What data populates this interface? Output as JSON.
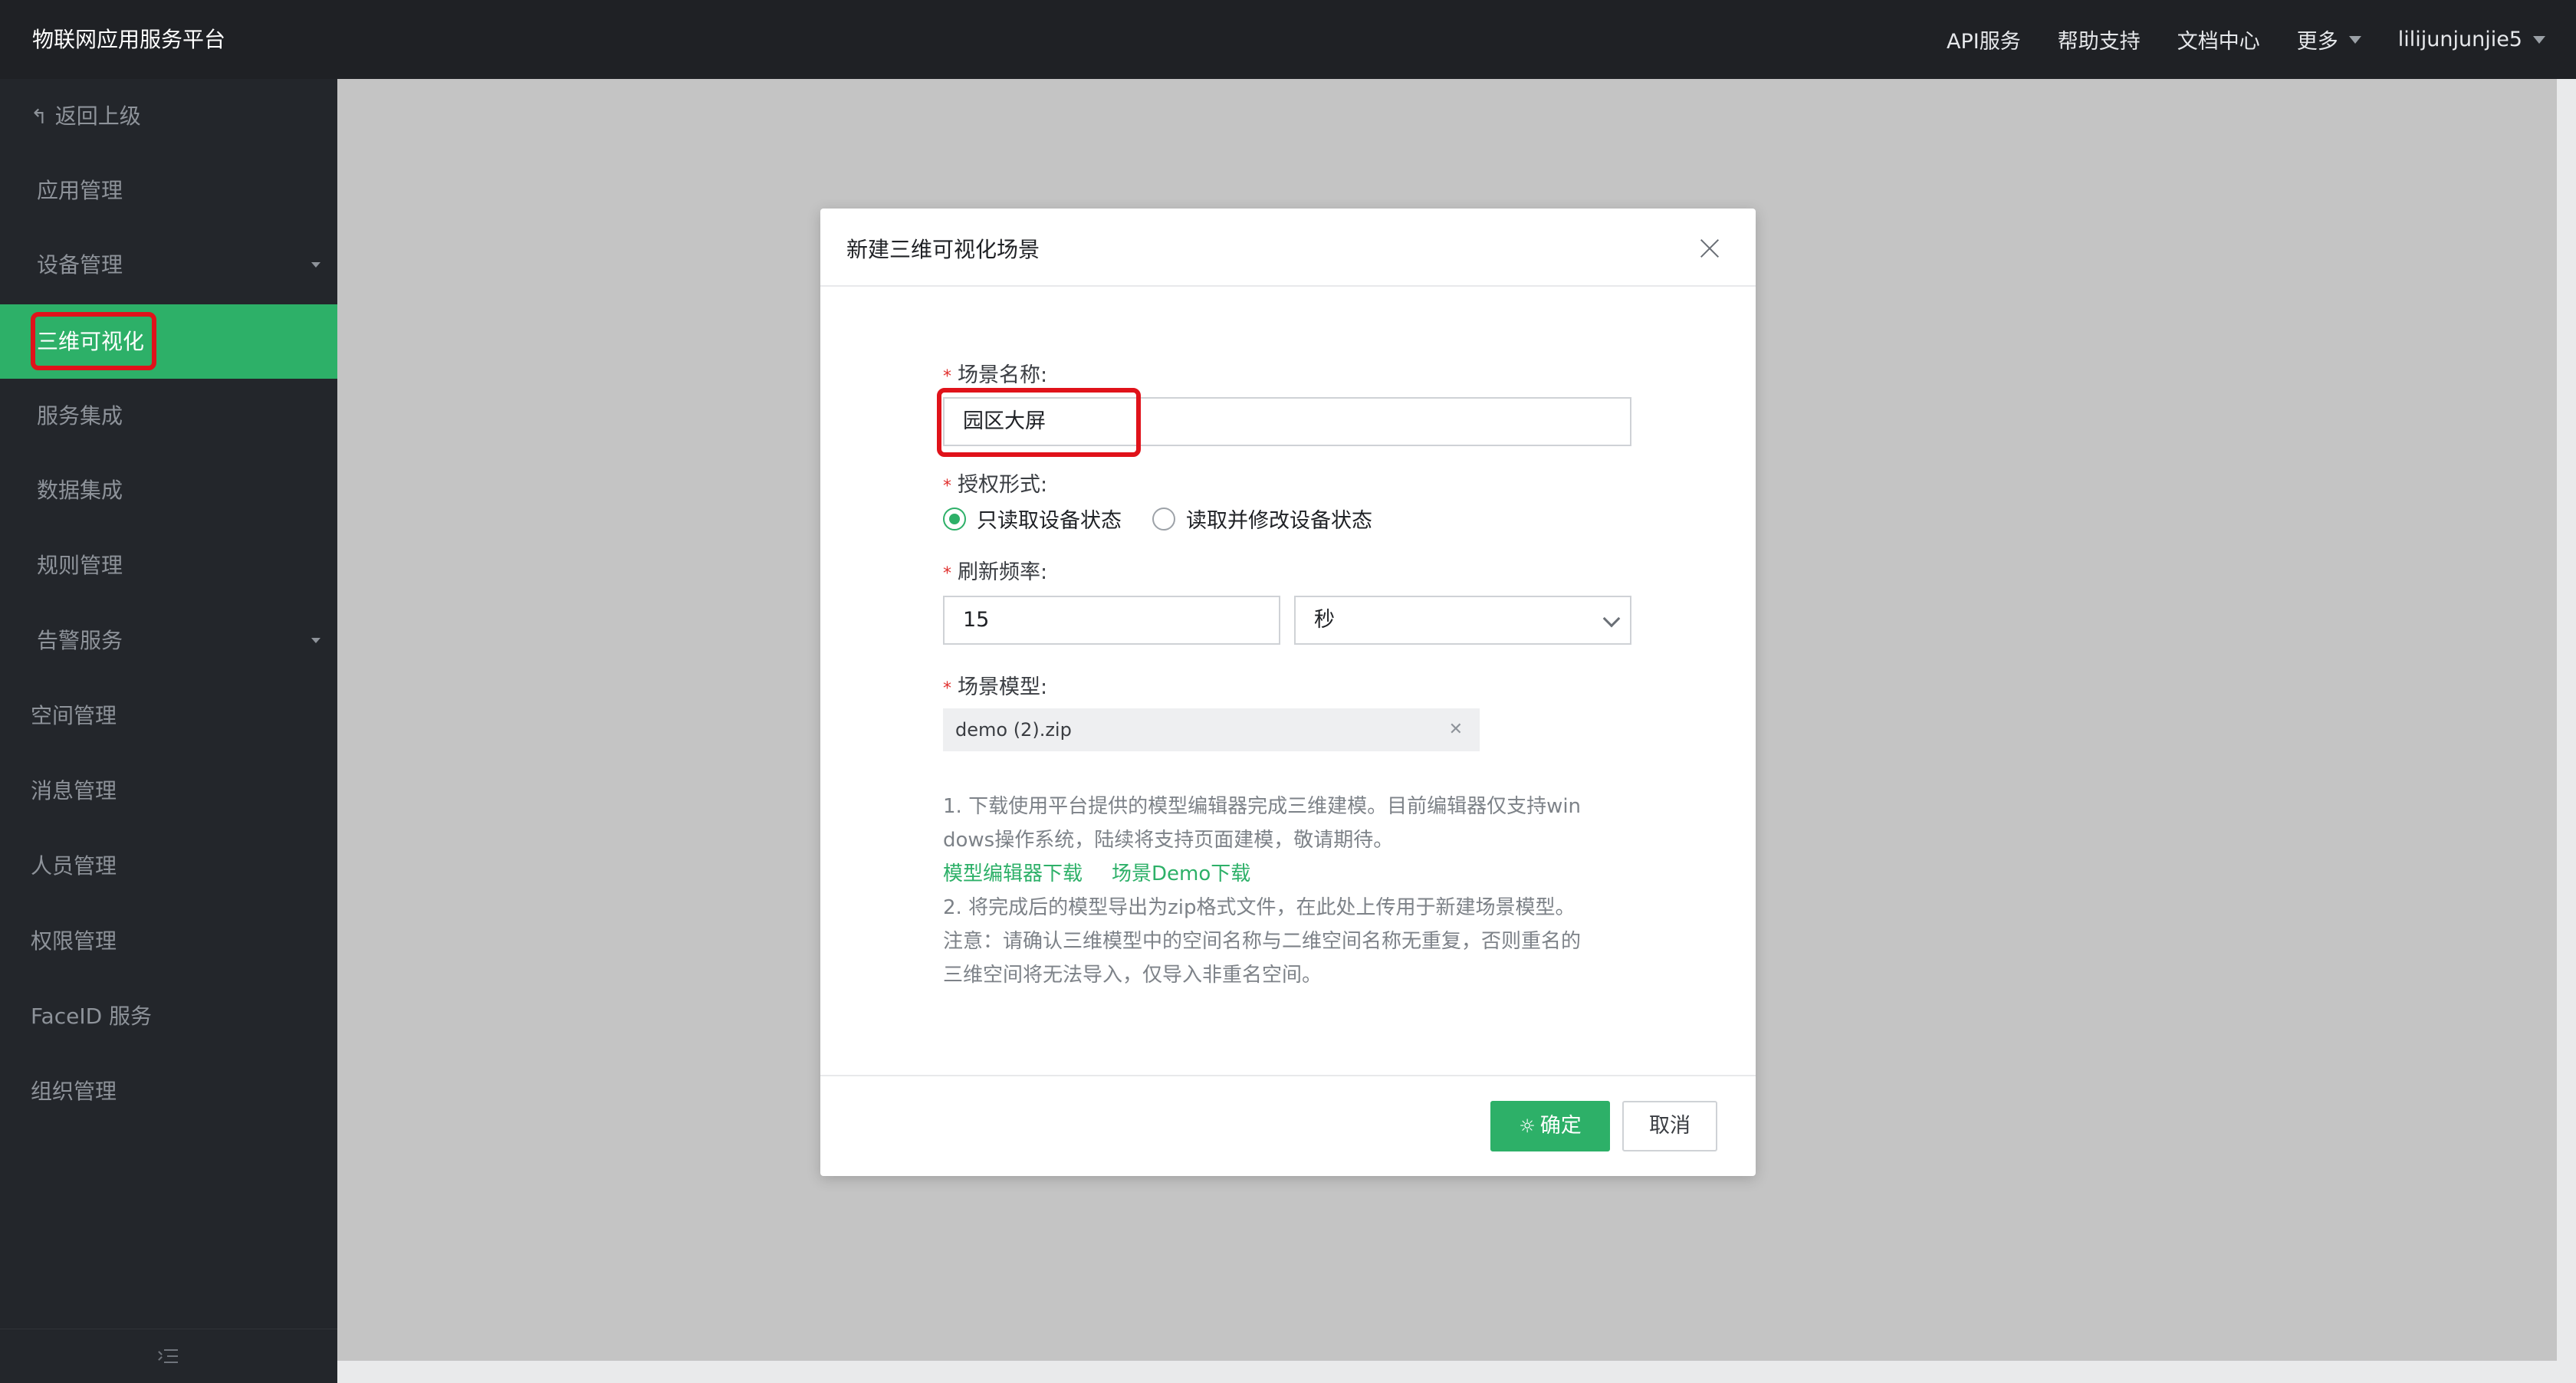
{
  "header": {
    "brand": "物联网应用服务平台",
    "nav": [
      "API服务",
      "帮助支持",
      "文档中心",
      "更多"
    ],
    "user": "lilijunjunjie5"
  },
  "sidebar": {
    "back": "返回上级",
    "items": [
      {
        "label": "应用管理"
      },
      {
        "label": "设备管理"
      },
      {
        "label": "三维可视化"
      },
      {
        "label": "服务集成"
      },
      {
        "label": "数据集成"
      },
      {
        "label": "规则管理"
      },
      {
        "label": "告警服务"
      },
      {
        "label": "空间管理"
      },
      {
        "label": "消息管理"
      },
      {
        "label": "人员管理"
      },
      {
        "label": "权限管理"
      },
      {
        "label": "FaceID 服务"
      },
      {
        "label": "组织管理"
      }
    ]
  },
  "modal": {
    "title": "新建三维可视化场景",
    "scene_name_label": "场景名称:",
    "scene_name_value": "园区大屏",
    "auth_label": "授权形式:",
    "auth_options": [
      "只读取设备状态",
      "读取并修改设备状态"
    ],
    "refresh_label": "刷新频率:",
    "refresh_value": "15",
    "refresh_unit": "秒",
    "model_label": "场景模型:",
    "model_file": "demo (2).zip",
    "help_line1": "1. 下载使用平台提供的模型编辑器完成三维建模。目前编辑器仅支持win",
    "help_line2": "dows操作系统，陆续将支持页面建模，敬请期待。",
    "link_editor": "模型编辑器下载",
    "link_demo": "场景Demo下载",
    "help_line3": "2. 将完成后的模型导出为zip格式文件，在此处上传用于新建场景模型。",
    "help_line4": "注意：请确认三维模型中的空间名称与二维空间名称无重复，否则重名的",
    "help_line5": "三维空间将无法导入，仅导入非重名空间。",
    "confirm": "确定",
    "cancel": "取消"
  },
  "colors": {
    "accent": "#2db068",
    "highlight": "#e0121a"
  }
}
